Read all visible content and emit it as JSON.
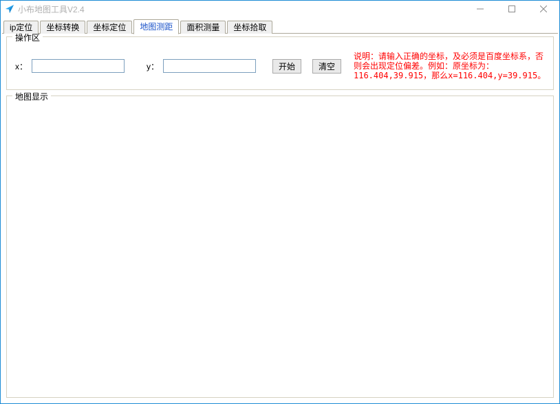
{
  "window": {
    "title": "小布地图工具V2.4",
    "icon_name": "paper-plane-icon"
  },
  "window_controls": {
    "minimize": "minimize",
    "maximize": "maximize",
    "close": "close"
  },
  "tabs": [
    {
      "label": "ip定位",
      "active": false
    },
    {
      "label": "坐标转换",
      "active": false
    },
    {
      "label": "坐标定位",
      "active": false
    },
    {
      "label": "地图测距",
      "active": true
    },
    {
      "label": "面积测量",
      "active": false
    },
    {
      "label": "坐标拾取",
      "active": false
    }
  ],
  "operation": {
    "legend": "操作区",
    "x_label": "x：",
    "y_label": "y：",
    "x_value": "",
    "y_value": "",
    "start_btn": "开始",
    "clear_btn": "清空",
    "note": "说明：请输入正确的坐标，及必须是百度坐标系，否则会出现定位偏差。例如：原坐标为：116.404,39.915，那么x=116.404,y=39.915。"
  },
  "map": {
    "legend": "地图显示"
  }
}
